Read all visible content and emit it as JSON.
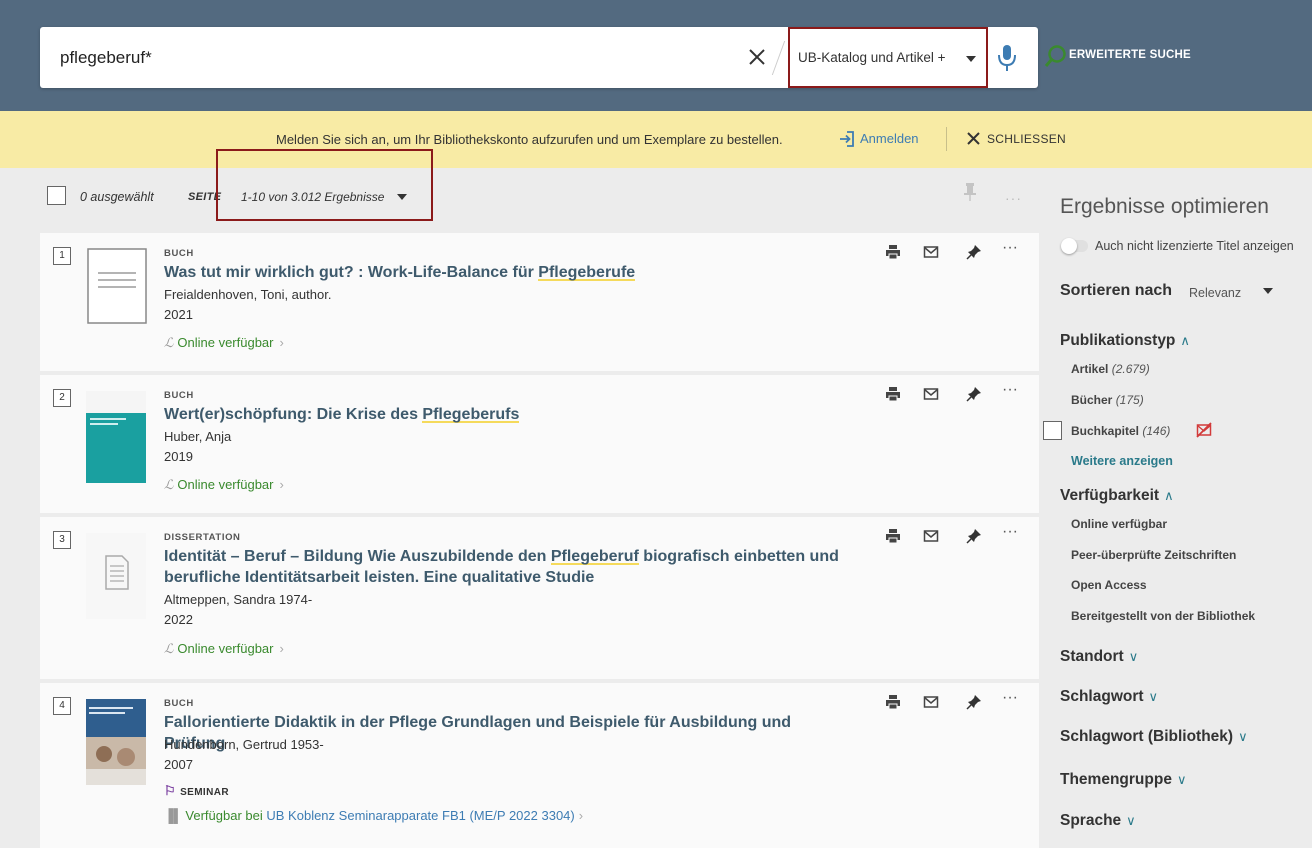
{
  "search": {
    "query": "pflegeberuf*",
    "scope": "UB-Katalog und Artikel +",
    "advanced_label": "ERWEITERTE SUCHE"
  },
  "login_bar": {
    "message": "Melden Sie sich an, um Ihr Bibliothekskonto aufzurufen und um Exemplare zu bestellen.",
    "login_link": "Anmelden",
    "close_label": "SCHLIESSEN"
  },
  "results_toolbar": {
    "selected": "0 ausgewählt",
    "page_label": "SEITE",
    "range": "1-10 von 3.012 Ergebnisse",
    "more": "···"
  },
  "results": [
    {
      "num": "1",
      "type": "BUCH",
      "title_pre": "Was tut mir wirklich gut? : Work-Life-Balance für ",
      "title_hl": "Pflegeberufe",
      "title_post": "",
      "author": "Freialdenhoven, Toni, author.",
      "year": "2021",
      "availability": "Online verfügbar"
    },
    {
      "num": "2",
      "type": "BUCH",
      "title_pre": "Wert(er)schöpfung: Die Krise des ",
      "title_hl": "Pflegeberufs",
      "title_post": "",
      "author": "Huber, Anja",
      "year": "2019",
      "availability": "Online verfügbar"
    },
    {
      "num": "3",
      "type": "DISSERTATION",
      "title_pre": "Identität – Beruf – Bildung Wie Auszubildende den ",
      "title_hl": "Pflegeberuf",
      "title_post": " biografisch einbetten und berufliche Identitätsarbeit leisten. Eine qualitative Studie",
      "author": "Altmeppen, Sandra 1974-",
      "year": "2022",
      "availability": "Online verfügbar"
    },
    {
      "num": "4",
      "type": "BUCH",
      "title_pre": "Fallorientierte Didaktik in der Pflege Grundlagen und Beispiele für Ausbildung und Prüfung",
      "title_hl": "",
      "title_post": "",
      "author": "Hundenborn, Gertrud 1953-",
      "year": "2007",
      "seminar": "SEMINAR",
      "holding_prefix": "Verfügbar bei",
      "holding_library": "UB Koblenz",
      "holding_location": "Seminarapparate FB1 (ME/P 2022 3304)"
    }
  ],
  "result_actions": {
    "more": "···"
  },
  "sidebar": {
    "title": "Ergebnisse optimieren",
    "toggle_label": "Auch nicht lizenzierte Titel anzeigen",
    "sort_label": "Sortieren nach",
    "sort_value": "Relevanz",
    "facets": {
      "publication_type": {
        "label": "Publikationstyp",
        "items": [
          {
            "label": "Artikel",
            "count": "(2.679)"
          },
          {
            "label": "Bücher",
            "count": "(175)"
          },
          {
            "label": "Buchkapitel",
            "count": "(146)"
          }
        ],
        "more_label": "Weitere anzeigen"
      },
      "availability": {
        "label": "Verfügbarkeit",
        "items": [
          "Online verfügbar",
          "Peer-überprüfte Zeitschriften",
          "Open Access",
          "Bereitgestellt von der Bibliothek"
        ]
      },
      "collapsed": [
        "Standort",
        "Schlagwort",
        "Schlagwort (Bibliothek)",
        "Themengruppe",
        "Sprache"
      ]
    }
  },
  "colors": {
    "header_bg": "#536a80",
    "login_bar_bg": "#f8eba5",
    "title_color": "#3e5a6c",
    "available_green": "#3a8a2e",
    "link_blue": "#3d7cb3",
    "highlight_yellow": "#f5da5b",
    "annotation_red": "#8b1a1a"
  }
}
